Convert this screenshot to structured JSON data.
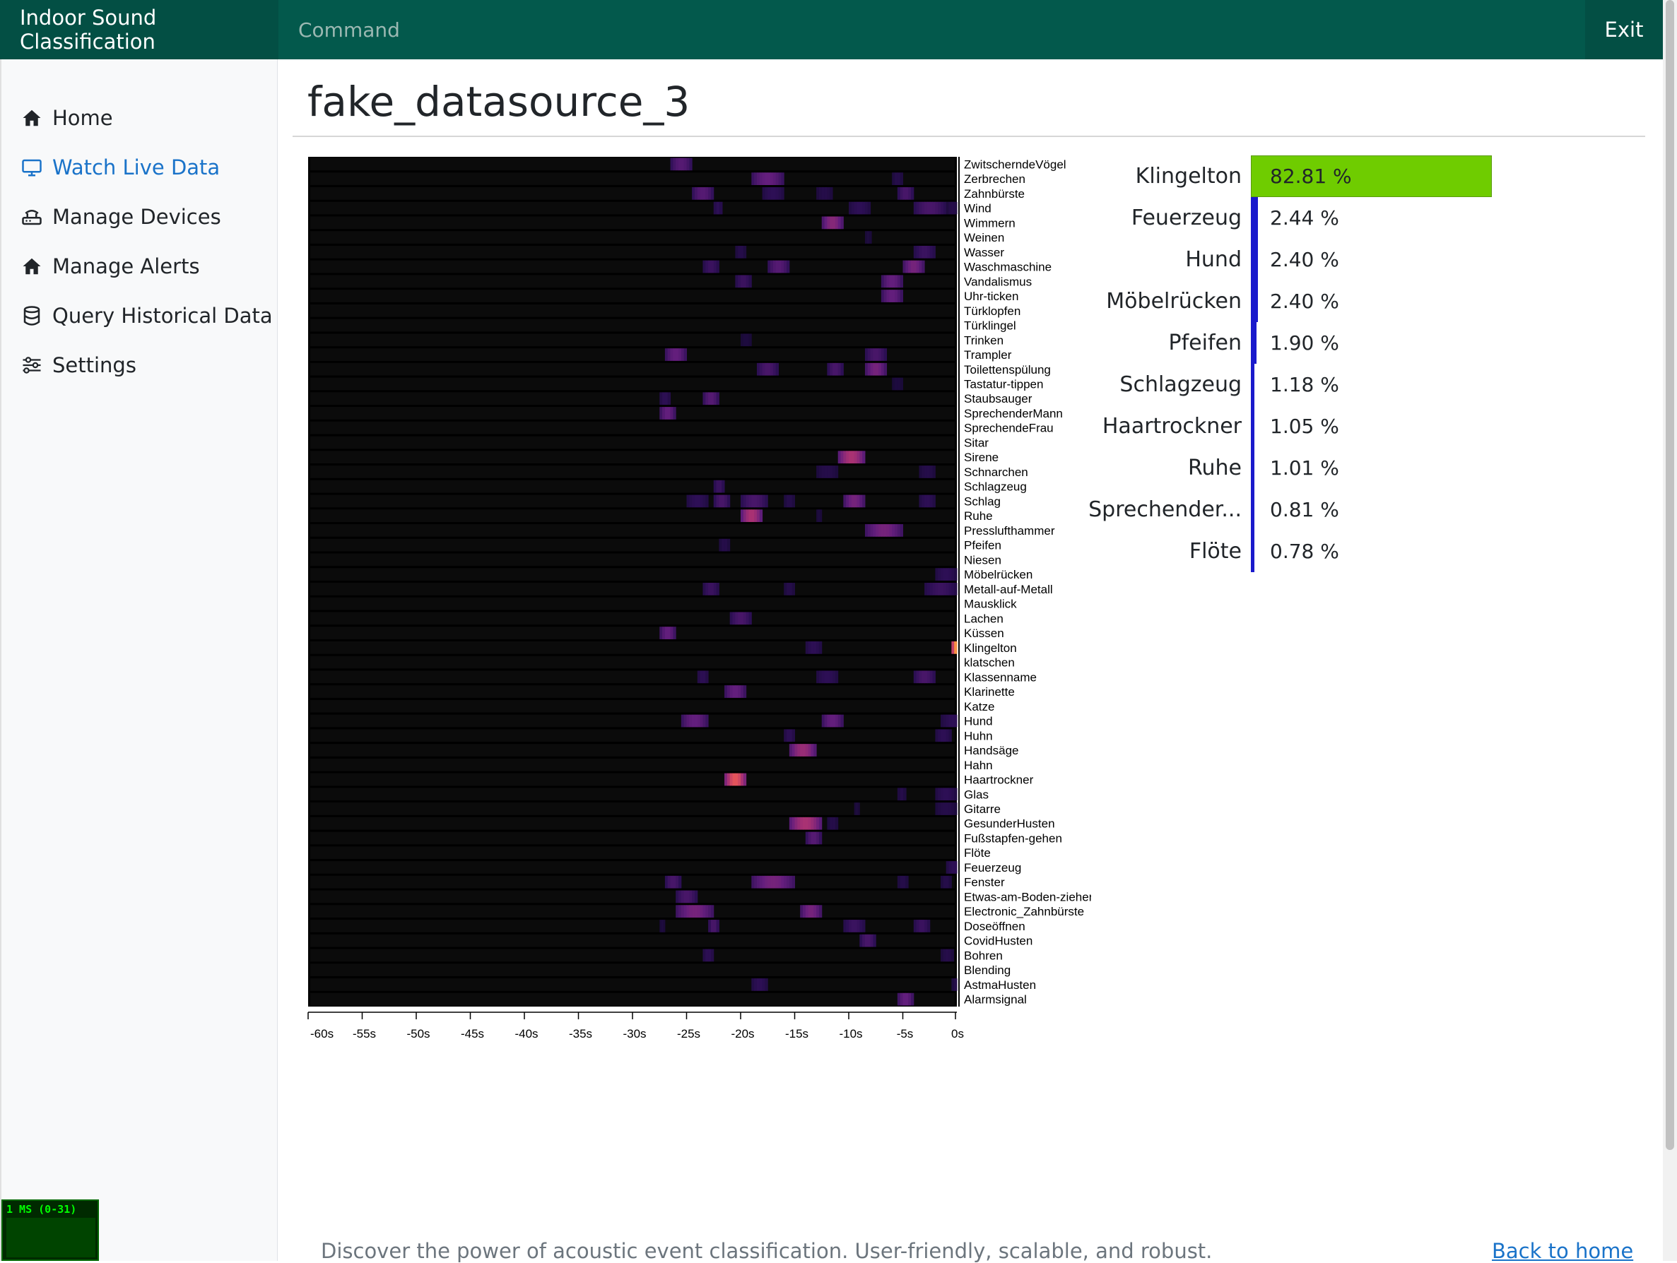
{
  "app": {
    "title": "Indoor Sound Classification",
    "command": "Command",
    "exit": "Exit"
  },
  "sidebar": {
    "items": [
      {
        "label": "Home",
        "icon": "home-icon",
        "active": false
      },
      {
        "label": "Watch Live Data",
        "icon": "monitor-icon",
        "active": true
      },
      {
        "label": "Manage Devices",
        "icon": "router-icon",
        "active": false
      },
      {
        "label": "Manage Alerts",
        "icon": "home-icon",
        "active": false
      },
      {
        "label": "Query Historical Data",
        "icon": "database-icon",
        "active": false
      },
      {
        "label": "Settings",
        "icon": "sliders-icon",
        "active": false
      }
    ]
  },
  "main": {
    "datasource": "fake_datasource_3"
  },
  "chart_data": {
    "type": "heatmap",
    "x_ticks": [
      "-60s",
      "-55s",
      "-50s",
      "-45s",
      "-40s",
      "-35s",
      "-30s",
      "-25s",
      "-20s",
      "-15s",
      "-10s",
      "-5s",
      "0s"
    ],
    "xlim": [
      -60,
      0
    ],
    "classes": [
      "ZwitscherndeVögel",
      "Zerbrechen",
      "Zahnbürste",
      "Wind",
      "Wimmern",
      "Weinen",
      "Wasser",
      "Waschmaschine",
      "Vandalismus",
      "Uhr-ticken",
      "Türklopfen",
      "Türklingel",
      "Trinken",
      "Trampler",
      "Toilettenspülung",
      "Tastatur-tippen",
      "Staubsauger",
      "SprechenderMann",
      "SprechendeFrau",
      "Sitar",
      "Sirene",
      "Schnarchen",
      "Schlagzeug",
      "Schlag",
      "Ruhe",
      "Presslufthammer",
      "Pfeifen",
      "Niesen",
      "Möbelrücken",
      "Metall-auf-Metall",
      "Mausklick",
      "Lachen",
      "Küssen",
      "Klingelton",
      "klatschen",
      "Klassenname",
      "Klarinette",
      "Katze",
      "Hund",
      "Huhn",
      "Handsäge",
      "Hahn",
      "Haartrockner",
      "Glas",
      "Gitarre",
      "GesunderHusten",
      "Fußstapfen-gehen",
      "Flöte",
      "Feuerzeug",
      "Fenster",
      "Etwas-am-Boden-ziehen",
      "Electronic_Zahnbürste",
      "Doseöffnen",
      "CovidHusten",
      "Bohren",
      "Blending",
      "AstmaHusten",
      "Alarmsignal"
    ],
    "events": [
      [
        0,
        -26.5,
        2,
        0.35
      ],
      [
        1,
        -19,
        3,
        0.4
      ],
      [
        1,
        -6,
        1,
        0.15
      ],
      [
        2,
        -24.5,
        2,
        0.35
      ],
      [
        2,
        -18,
        2,
        0.2
      ],
      [
        2,
        -13,
        1.5,
        0.15
      ],
      [
        2,
        -5.5,
        1.5,
        0.3
      ],
      [
        3,
        -22.5,
        0.8,
        0.2
      ],
      [
        3,
        -10,
        2,
        0.2
      ],
      [
        3,
        -4,
        3,
        0.3
      ],
      [
        3,
        -1,
        1.2,
        0.15
      ],
      [
        4,
        -12.5,
        2,
        0.5
      ],
      [
        5,
        -8.5,
        0.6,
        0.1
      ],
      [
        6,
        -20.5,
        1,
        0.15
      ],
      [
        6,
        -4,
        2,
        0.25
      ],
      [
        7,
        -23.5,
        1.5,
        0.25
      ],
      [
        7,
        -17.5,
        2,
        0.35
      ],
      [
        7,
        -5,
        2,
        0.45
      ],
      [
        8,
        -20.5,
        1.5,
        0.25
      ],
      [
        8,
        -7,
        2,
        0.4
      ],
      [
        9,
        -7,
        2,
        0.4
      ],
      [
        12,
        -20,
        1,
        0.1
      ],
      [
        13,
        -27,
        2,
        0.4
      ],
      [
        13,
        -8.5,
        2,
        0.3
      ],
      [
        14,
        -18.5,
        2,
        0.3
      ],
      [
        14,
        -12,
        1.5,
        0.3
      ],
      [
        14,
        -8.5,
        2,
        0.45
      ],
      [
        15,
        -6,
        1,
        0.1
      ],
      [
        16,
        -27.5,
        1,
        0.2
      ],
      [
        16,
        -23.5,
        1.5,
        0.35
      ],
      [
        17,
        -27.5,
        1.5,
        0.4
      ],
      [
        20,
        -11,
        2.5,
        0.6
      ],
      [
        21,
        -13,
        2,
        0.15
      ],
      [
        21,
        -3.5,
        1.5,
        0.15
      ],
      [
        22,
        -22.5,
        1,
        0.25
      ],
      [
        23,
        -25,
        2,
        0.2
      ],
      [
        23,
        -22.5,
        1.5,
        0.3
      ],
      [
        23,
        -20,
        2.5,
        0.3
      ],
      [
        23,
        -16,
        1,
        0.15
      ],
      [
        23,
        -10.5,
        2,
        0.45
      ],
      [
        23,
        -3.5,
        1.5,
        0.2
      ],
      [
        24,
        -20,
        2,
        0.6
      ],
      [
        24,
        -13,
        0.5,
        0.1
      ],
      [
        25,
        -8.5,
        3.5,
        0.45
      ],
      [
        26,
        -22,
        1,
        0.15
      ],
      [
        28,
        -2,
        2,
        0.2
      ],
      [
        29,
        -23.5,
        1.5,
        0.25
      ],
      [
        29,
        -16,
        1,
        0.15
      ],
      [
        29,
        -3,
        3,
        0.25
      ],
      [
        31,
        -21,
        2,
        0.3
      ],
      [
        32,
        -27.5,
        1.5,
        0.4
      ],
      [
        33,
        -14,
        1.5,
        0.2
      ],
      [
        33,
        -0.5,
        1.5,
        1.0
      ],
      [
        35,
        -24,
        1,
        0.2
      ],
      [
        35,
        -13,
        2,
        0.2
      ],
      [
        35,
        -4,
        2,
        0.3
      ],
      [
        36,
        -21.5,
        2,
        0.4
      ],
      [
        38,
        -25.5,
        2.5,
        0.4
      ],
      [
        38,
        -12.5,
        2,
        0.4
      ],
      [
        38,
        -1.5,
        2.5,
        0.2
      ],
      [
        39,
        -16,
        1,
        0.2
      ],
      [
        39,
        -2,
        1.5,
        0.2
      ],
      [
        40,
        -15.5,
        2.5,
        0.55
      ],
      [
        42,
        -21.5,
        2,
        0.75
      ],
      [
        43,
        -5.5,
        0.8,
        0.15
      ],
      [
        43,
        -2,
        2,
        0.2
      ],
      [
        44,
        -9.5,
        0.5,
        0.1
      ],
      [
        44,
        -2,
        2,
        0.15
      ],
      [
        45,
        -15.5,
        3,
        0.6
      ],
      [
        45,
        -12,
        1,
        0.15
      ],
      [
        46,
        -14,
        1.5,
        0.35
      ],
      [
        48,
        -1,
        1.5,
        0.2
      ],
      [
        49,
        -27,
        1.5,
        0.3
      ],
      [
        49,
        -19,
        4,
        0.45
      ],
      [
        49,
        -5.5,
        1,
        0.15
      ],
      [
        49,
        -1.5,
        1,
        0.15
      ],
      [
        50,
        -26,
        2,
        0.3
      ],
      [
        51,
        -26,
        3.5,
        0.45
      ],
      [
        51,
        -14.5,
        2,
        0.45
      ],
      [
        52,
        -27.5,
        0.5,
        0.1
      ],
      [
        52,
        -23,
        1,
        0.3
      ],
      [
        52,
        -10.5,
        2,
        0.25
      ],
      [
        52,
        -4,
        1.5,
        0.25
      ],
      [
        53,
        -9,
        1.5,
        0.3
      ],
      [
        54,
        -23.5,
        1,
        0.2
      ],
      [
        54,
        -1.5,
        1.2,
        0.15
      ],
      [
        56,
        -19,
        1.5,
        0.2
      ],
      [
        56,
        -0.5,
        1,
        0.15
      ],
      [
        57,
        -5.5,
        1.5,
        0.4
      ]
    ]
  },
  "predictions": [
    {
      "label": "Klingelton",
      "value_text": "82.81 %",
      "fraction": 0.8281,
      "color": "#6fcc00"
    },
    {
      "label": "Feuerzeug",
      "value_text": "2.44 %",
      "fraction": 0.0244,
      "color": "#1a1acc"
    },
    {
      "label": "Hund",
      "value_text": "2.40 %",
      "fraction": 0.024,
      "color": "#1a1acc"
    },
    {
      "label": "Möbelrücken",
      "value_text": "2.40 %",
      "fraction": 0.024,
      "color": "#1a1acc"
    },
    {
      "label": "Pfeifen",
      "value_text": "1.90 %",
      "fraction": 0.019,
      "color": "#1a1acc"
    },
    {
      "label": "Schlagzeug",
      "value_text": "1.18 %",
      "fraction": 0.0118,
      "color": "#1a1acc"
    },
    {
      "label": "Haartrockner",
      "value_text": "1.05 %",
      "fraction": 0.0105,
      "color": "#1a1acc"
    },
    {
      "label": "Ruhe",
      "value_text": "1.01 %",
      "fraction": 0.0101,
      "color": "#1a1acc"
    },
    {
      "label": "Sprechender...",
      "value_text": "0.81 %",
      "fraction": 0.0081,
      "color": "#1a1acc"
    },
    {
      "label": "Flöte",
      "value_text": "0.78 %",
      "fraction": 0.0078,
      "color": "#1a1acc"
    }
  ],
  "footer": {
    "tagline": "Discover the power of acoustic event classification. User-friendly, scalable, and robust.",
    "back_link": "Back to home"
  },
  "fps": {
    "label": "1 MS (0-31)"
  }
}
